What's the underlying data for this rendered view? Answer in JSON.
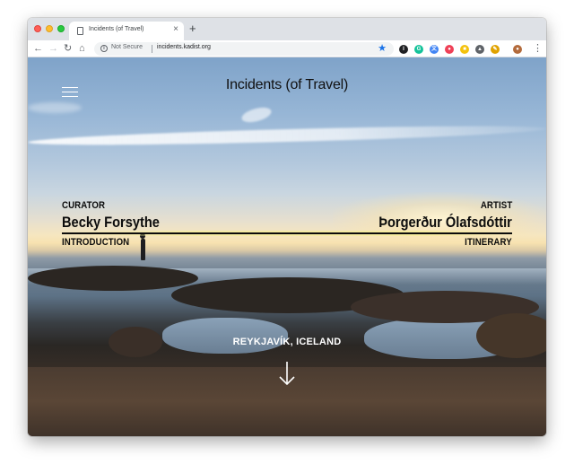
{
  "browser": {
    "tab_title": "Incidents (of Travel)",
    "tab_close": "×",
    "new_tab": "+",
    "security_label": "Not Secure",
    "url": "incidents.kadist.org",
    "nav": {
      "back": "←",
      "forward": "→",
      "reload": "↻",
      "home": "⌂"
    },
    "star": "★",
    "extensions": [
      {
        "name": "instapaper-extension-icon",
        "glyph": "I",
        "color": "#202124"
      },
      {
        "name": "grammarly-extension-icon",
        "glyph": "G",
        "color": "#15c39a"
      },
      {
        "name": "translate-extension-icon",
        "glyph": "文",
        "color": "#4285f4"
      },
      {
        "name": "pocket-extension-icon",
        "glyph": "●",
        "color": "#ef4056"
      },
      {
        "name": "notes-extension-icon",
        "glyph": "■",
        "color": "#f4c20d"
      },
      {
        "name": "extension-icon",
        "glyph": "▲",
        "color": "#5f6368"
      },
      {
        "name": "eyedropper-extension-icon",
        "glyph": "✎",
        "color": "#e0a200"
      },
      {
        "name": "profile-avatar-icon",
        "glyph": "●",
        "color": "#b36b3c"
      }
    ],
    "menu_glyph": "⋮"
  },
  "page": {
    "title": "Incidents (of Travel)",
    "curator": {
      "label": "CURATOR",
      "name": "Becky Forsythe",
      "link": "INTRODUCTION"
    },
    "artist": {
      "label": "ARTIST",
      "name": "Þorgerður Ólafsdóttir",
      "link": "ITINERARY"
    },
    "location": "REYKJAVÍK, ICELAND"
  },
  "colors": {
    "accent_star": "#1a73e8",
    "text_dark": "#0c0c0c",
    "text_light": "#ffffff"
  }
}
